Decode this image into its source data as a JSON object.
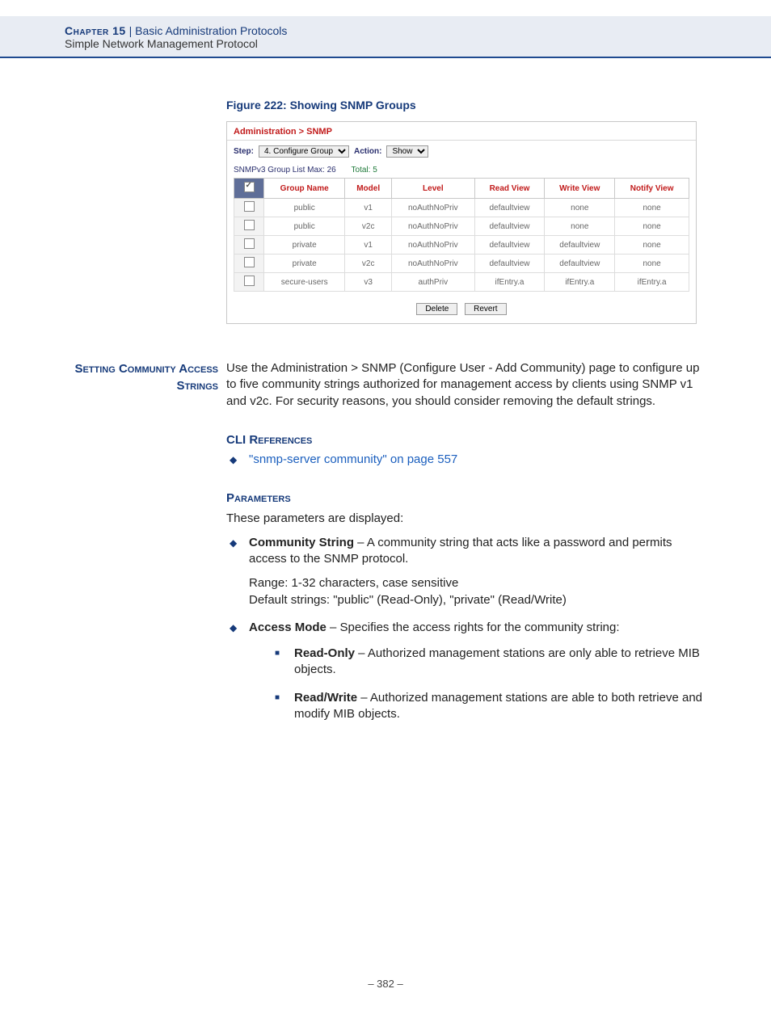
{
  "header": {
    "chapter": "Chapter 15",
    "separator": "  |  ",
    "chapter_title": "Basic Administration Protocols",
    "section": "Simple Network Management Protocol"
  },
  "figure": {
    "caption": "Figure 222:  Showing SNMP Groups"
  },
  "ui": {
    "breadcrumb": "Administration > SNMP",
    "step_label": "Step:",
    "step_value": "4. Configure Group",
    "action_label": "Action:",
    "action_value": "Show",
    "list_title": "SNMPv3 Group List",
    "max_label": "Max: 26",
    "total_label": "Total: 5",
    "columns": [
      "Group Name",
      "Model",
      "Level",
      "Read View",
      "Write View",
      "Notify View"
    ],
    "rows": [
      [
        "public",
        "v1",
        "noAuthNoPriv",
        "defaultview",
        "none",
        "none"
      ],
      [
        "public",
        "v2c",
        "noAuthNoPriv",
        "defaultview",
        "none",
        "none"
      ],
      [
        "private",
        "v1",
        "noAuthNoPriv",
        "defaultview",
        "defaultview",
        "none"
      ],
      [
        "private",
        "v2c",
        "noAuthNoPriv",
        "defaultview",
        "defaultview",
        "none"
      ],
      [
        "secure-users",
        "v3",
        "authPriv",
        "ifEntry.a",
        "ifEntry.a",
        "ifEntry.a"
      ]
    ],
    "delete_btn": "Delete",
    "revert_btn": "Revert"
  },
  "margin_heading": "Setting Community Access Strings",
  "intro_para": "Use the Administration > SNMP (Configure User - Add Community) page to configure up to five community strings authorized for management access by clients using SNMP v1 and v2c. For security reasons, you should consider removing the default strings.",
  "cli": {
    "heading": "CLI References",
    "link": "\"snmp-server community\" on page 557"
  },
  "params": {
    "heading": "Parameters",
    "intro": "These parameters are displayed:",
    "community": {
      "name": "Community String",
      "desc": " – A community string that acts like a password and permits access to the SNMP protocol.",
      "range": "Range: 1-32 characters, case sensitive",
      "defaults": "Default strings: \"public\" (Read-Only), \"private\" (Read/Write)"
    },
    "access_mode": {
      "name": "Access Mode",
      "desc": " – Specifies the access rights for the community string:",
      "ro_name": "Read-Only",
      "ro_desc": " – Authorized management stations are only able to retrieve MIB objects.",
      "rw_name": "Read/Write",
      "rw_desc": " – Authorized management stations are able to both retrieve and modify MIB objects."
    }
  },
  "footer": "–  382  –"
}
